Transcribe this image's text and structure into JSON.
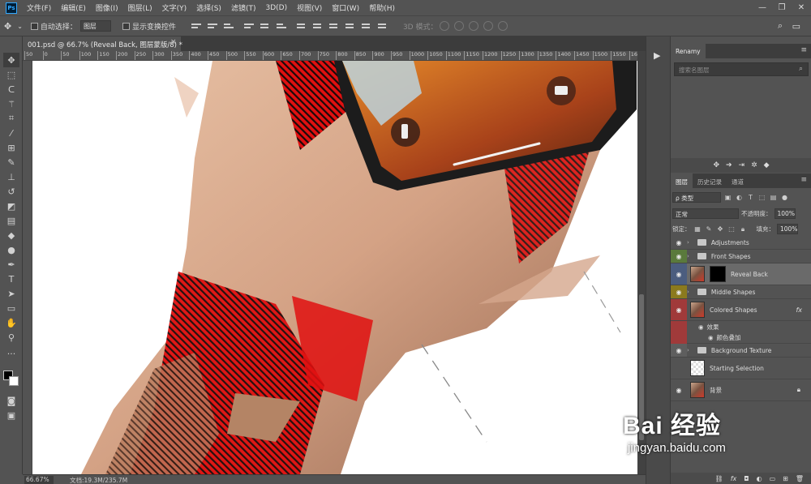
{
  "app": {
    "logo": "Ps"
  },
  "menu": [
    "文件(F)",
    "编辑(E)",
    "图像(I)",
    "图层(L)",
    "文字(Y)",
    "选择(S)",
    "滤镜(T)",
    "3D(D)",
    "视图(V)",
    "窗口(W)",
    "帮助(H)"
  ],
  "options": {
    "auto_select_label": "自动选择：",
    "auto_select_value": "图层",
    "show_transform_label": "显示变换控件",
    "mode_3d_label": "3D 模式："
  },
  "document": {
    "tab_title": "001.psd @ 66.7% (Reveal Back, 图层蒙版/8) *",
    "close": "×"
  },
  "ruler": {
    "ticks": [
      "50",
      "0",
      "50",
      "100",
      "150",
      "200",
      "250",
      "300",
      "350",
      "400",
      "450",
      "500",
      "550",
      "600",
      "650",
      "700",
      "750",
      "800",
      "850",
      "900",
      "950",
      "1000",
      "1050",
      "1100",
      "1150",
      "1200",
      "1250",
      "1300",
      "1350",
      "1400",
      "1450",
      "1500",
      "1550",
      "1600"
    ]
  },
  "status": {
    "zoom": "66.67%",
    "doc_size": "文档:19.3M/235.7M"
  },
  "renamy": {
    "tab": "Renamy",
    "search_placeholder": "搜索名图层"
  },
  "layers_panel": {
    "tabs": [
      "图层",
      "历史记录",
      "通道"
    ],
    "kind_filter": "ρ 类型",
    "blend_mode": "正常",
    "opacity_label": "不透明度：",
    "opacity_value": "100%",
    "lock_label": "锁定：",
    "fill_label": "填充：",
    "fill_value": "100%",
    "layers": [
      {
        "name": "Adjustments",
        "type": "group",
        "eye_color": "none"
      },
      {
        "name": "Front Shapes",
        "type": "group",
        "eye_color": "green"
      },
      {
        "name": "Reveal Back",
        "type": "masked",
        "eye_color": "blue",
        "selected": true
      },
      {
        "name": "Middle Shapes",
        "type": "group",
        "eye_color": "yellow"
      },
      {
        "name": "Colored Shapes",
        "type": "photo",
        "eye_color": "red",
        "fx": "fx"
      },
      {
        "name": "Background Texture",
        "type": "group",
        "eye_color": "none"
      },
      {
        "name": "Starting Selection",
        "type": "checker",
        "eye_color": "hidden"
      },
      {
        "name": "背景",
        "type": "photo",
        "eye_color": "none",
        "locked": true
      }
    ],
    "effects_label": "效果",
    "effect_item": "颜色叠加"
  },
  "watermark": {
    "logo": "Bai  经验",
    "url": "jingyan.baidu.com"
  },
  "colors": {
    "accent_red": "#e01010",
    "skin": "#c8937a",
    "panel_bg": "#535353"
  }
}
